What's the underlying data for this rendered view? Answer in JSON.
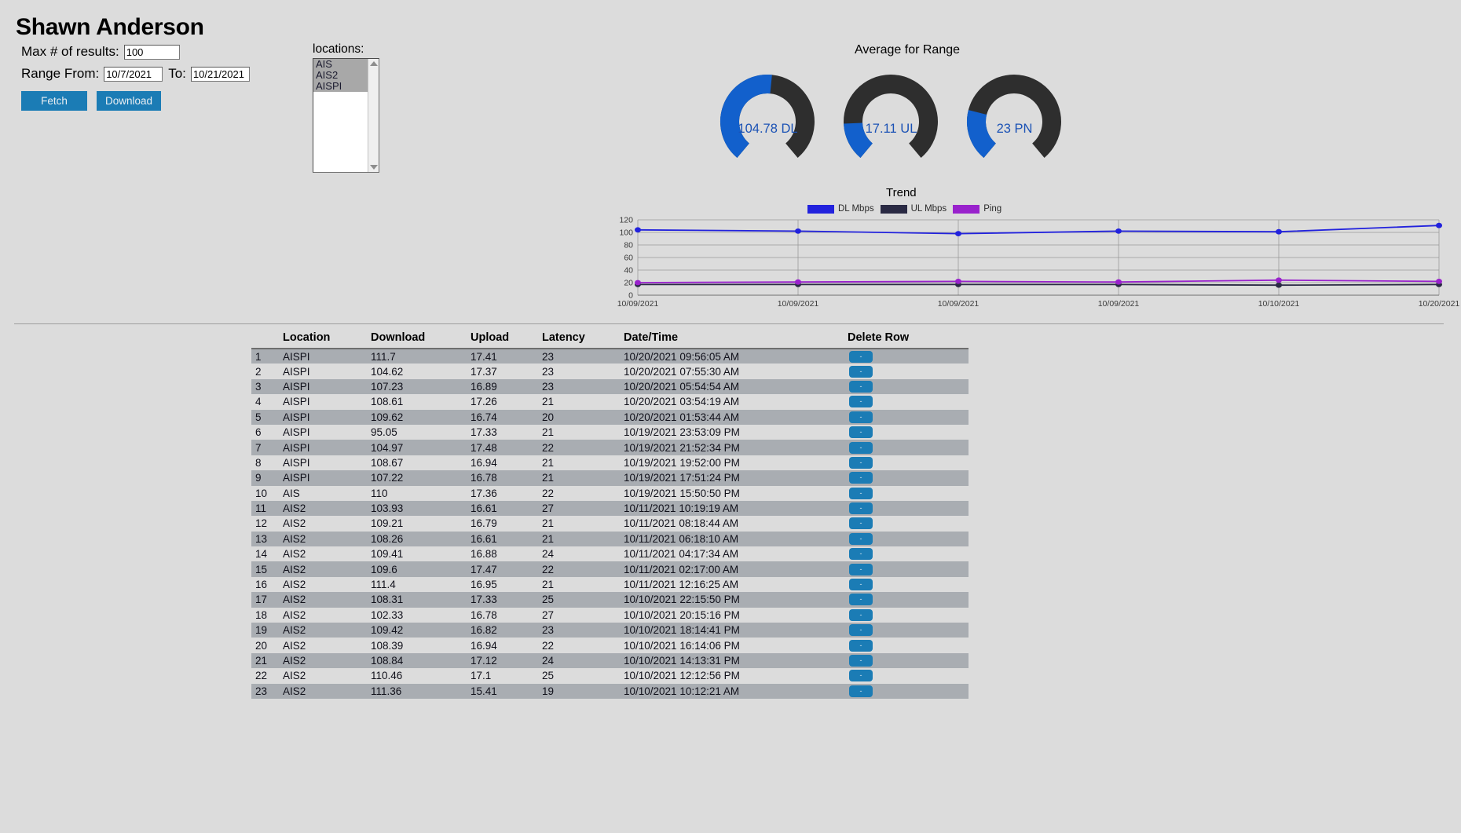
{
  "header": {
    "title": "Shawn Anderson"
  },
  "form": {
    "max_results_label": "Max # of results:",
    "max_results_value": "100",
    "range_from_label": "Range From:",
    "range_from_value": "10/7/2021",
    "to_label": "To:",
    "to_value": "10/21/2021",
    "fetch_label": "Fetch",
    "download_label": "Download"
  },
  "locations": {
    "label": "locations:",
    "items": [
      {
        "label": "AIS",
        "selected": true
      },
      {
        "label": "AIS2",
        "selected": true
      },
      {
        "label": "AISPI",
        "selected": true
      }
    ]
  },
  "gauges": {
    "title": "Average for Range",
    "accent_fill": "#1260cc",
    "accent_track": "#2e2e2e",
    "value_color": "#1b52b5",
    "items": [
      {
        "label": "104.78 DL",
        "value": 104.78,
        "max": 200,
        "pct": 52
      },
      {
        "label": "17.11 UL",
        "value": 17.11,
        "max": 100,
        "pct": 17
      },
      {
        "label": "23 PN",
        "value": 23,
        "max": 100,
        "pct": 23
      }
    ]
  },
  "chart_data": {
    "type": "line",
    "title": "Trend",
    "xlabel": "",
    "ylabel": "",
    "ylim": [
      0,
      120
    ],
    "yticks": [
      0,
      20,
      40,
      60,
      80,
      100,
      120
    ],
    "grid": true,
    "legend_position": "top",
    "x": [
      "10/09/2021",
      "10/09/2021",
      "10/09/2021",
      "10/09/2021",
      "10/10/2021",
      "10/20/2021"
    ],
    "series": [
      {
        "name": "DL Mbps",
        "color": "#2222dd",
        "values": [
          104,
          102,
          98,
          102,
          101,
          111
        ]
      },
      {
        "name": "UL Mbps",
        "color": "#2a2a44",
        "values": [
          17,
          17,
          17,
          17,
          16,
          17
        ]
      },
      {
        "name": "Ping",
        "color": "#9922cc",
        "values": [
          20,
          21,
          22,
          21,
          24,
          22
        ]
      }
    ]
  },
  "table": {
    "columns": [
      "",
      "Location",
      "Download",
      "Upload",
      "Latency",
      "Date/Time",
      "Delete Row"
    ],
    "delete_button_label": "-",
    "rows": [
      {
        "idx": "1",
        "location": "AISPI",
        "download": "111.7",
        "upload": "17.41",
        "latency": "23",
        "datetime": "10/20/2021 09:56:05 AM"
      },
      {
        "idx": "2",
        "location": "AISPI",
        "download": "104.62",
        "upload": "17.37",
        "latency": "23",
        "datetime": "10/20/2021 07:55:30 AM"
      },
      {
        "idx": "3",
        "location": "AISPI",
        "download": "107.23",
        "upload": "16.89",
        "latency": "23",
        "datetime": "10/20/2021 05:54:54 AM"
      },
      {
        "idx": "4",
        "location": "AISPI",
        "download": "108.61",
        "upload": "17.26",
        "latency": "21",
        "datetime": "10/20/2021 03:54:19 AM"
      },
      {
        "idx": "5",
        "location": "AISPI",
        "download": "109.62",
        "upload": "16.74",
        "latency": "20",
        "datetime": "10/20/2021 01:53:44 AM"
      },
      {
        "idx": "6",
        "location": "AISPI",
        "download": "95.05",
        "upload": "17.33",
        "latency": "21",
        "datetime": "10/19/2021 23:53:09 PM"
      },
      {
        "idx": "7",
        "location": "AISPI",
        "download": "104.97",
        "upload": "17.48",
        "latency": "22",
        "datetime": "10/19/2021 21:52:34 PM"
      },
      {
        "idx": "8",
        "location": "AISPI",
        "download": "108.67",
        "upload": "16.94",
        "latency": "21",
        "datetime": "10/19/2021 19:52:00 PM"
      },
      {
        "idx": "9",
        "location": "AISPI",
        "download": "107.22",
        "upload": "16.78",
        "latency": "21",
        "datetime": "10/19/2021 17:51:24 PM"
      },
      {
        "idx": "10",
        "location": "AIS",
        "download": "110",
        "upload": "17.36",
        "latency": "22",
        "datetime": "10/19/2021 15:50:50 PM"
      },
      {
        "idx": "11",
        "location": "AIS2",
        "download": "103.93",
        "upload": "16.61",
        "latency": "27",
        "datetime": "10/11/2021 10:19:19 AM"
      },
      {
        "idx": "12",
        "location": "AIS2",
        "download": "109.21",
        "upload": "16.79",
        "latency": "21",
        "datetime": "10/11/2021 08:18:44 AM"
      },
      {
        "idx": "13",
        "location": "AIS2",
        "download": "108.26",
        "upload": "16.61",
        "latency": "21",
        "datetime": "10/11/2021 06:18:10 AM"
      },
      {
        "idx": "14",
        "location": "AIS2",
        "download": "109.41",
        "upload": "16.88",
        "latency": "24",
        "datetime": "10/11/2021 04:17:34 AM"
      },
      {
        "idx": "15",
        "location": "AIS2",
        "download": "109.6",
        "upload": "17.47",
        "latency": "22",
        "datetime": "10/11/2021 02:17:00 AM"
      },
      {
        "idx": "16",
        "location": "AIS2",
        "download": "111.4",
        "upload": "16.95",
        "latency": "21",
        "datetime": "10/11/2021 12:16:25 AM"
      },
      {
        "idx": "17",
        "location": "AIS2",
        "download": "108.31",
        "upload": "17.33",
        "latency": "25",
        "datetime": "10/10/2021 22:15:50 PM"
      },
      {
        "idx": "18",
        "location": "AIS2",
        "download": "102.33",
        "upload": "16.78",
        "latency": "27",
        "datetime": "10/10/2021 20:15:16 PM"
      },
      {
        "idx": "19",
        "location": "AIS2",
        "download": "109.42",
        "upload": "16.82",
        "latency": "23",
        "datetime": "10/10/2021 18:14:41 PM"
      },
      {
        "idx": "20",
        "location": "AIS2",
        "download": "108.39",
        "upload": "16.94",
        "latency": "22",
        "datetime": "10/10/2021 16:14:06 PM"
      },
      {
        "idx": "21",
        "location": "AIS2",
        "download": "108.84",
        "upload": "17.12",
        "latency": "24",
        "datetime": "10/10/2021 14:13:31 PM"
      },
      {
        "idx": "22",
        "location": "AIS2",
        "download": "110.46",
        "upload": "17.1",
        "latency": "25",
        "datetime": "10/10/2021 12:12:56 PM"
      },
      {
        "idx": "23",
        "location": "AIS2",
        "download": "111.36",
        "upload": "15.41",
        "latency": "19",
        "datetime": "10/10/2021 10:12:21 AM"
      }
    ]
  }
}
